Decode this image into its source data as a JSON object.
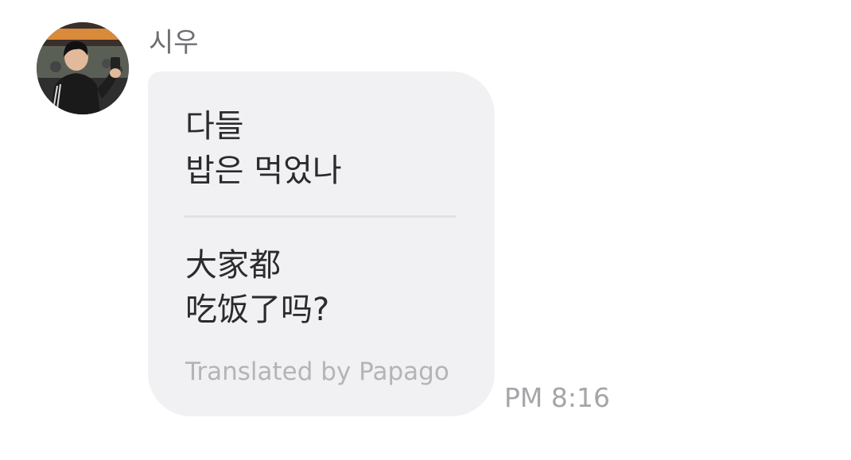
{
  "message": {
    "sender": {
      "name": "시우",
      "avatar_icon": "profile-photo"
    },
    "original_lines": [
      "다들",
      "밥은 먹었나"
    ],
    "translated_lines": [
      "大家都",
      "吃饭了吗?"
    ],
    "translation_credit": "Translated by Papago",
    "timestamp": "PM 8:16"
  },
  "colors": {
    "bubble_background": "#f1f1f3",
    "message_text": "#2b2b2e",
    "secondary_text": "#a6a6aa",
    "divider": "#e1e1e5"
  }
}
